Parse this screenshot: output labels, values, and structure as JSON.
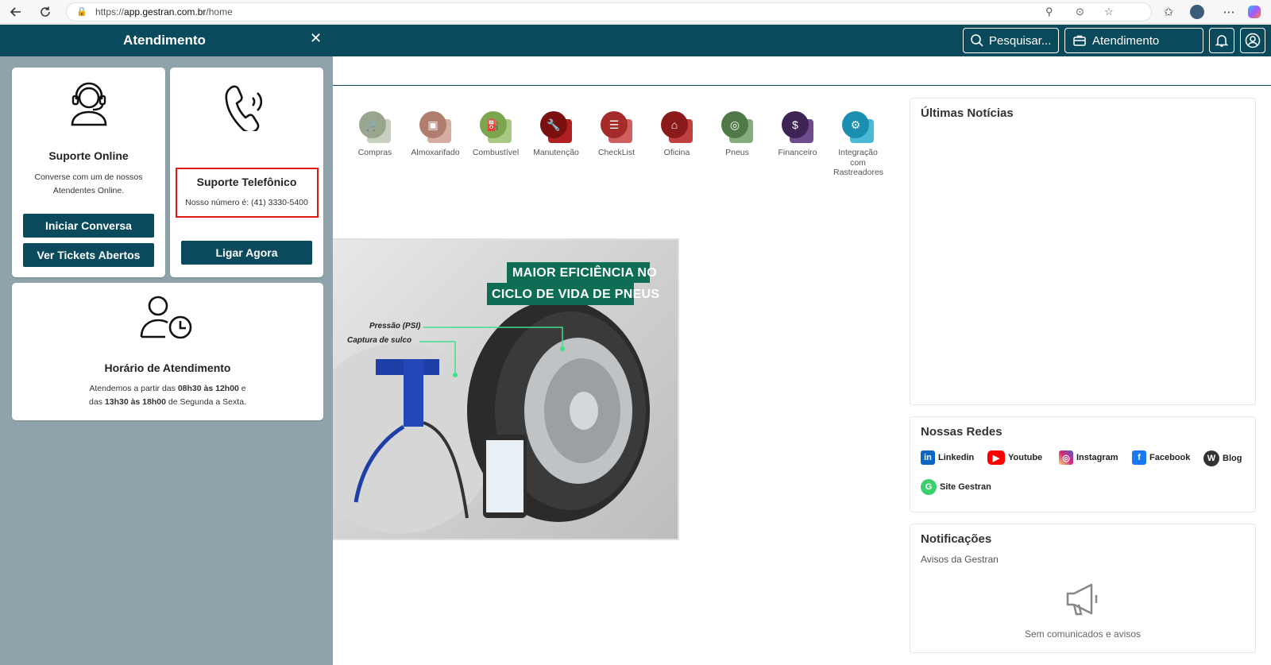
{
  "browser": {
    "url_scheme": "https://",
    "url_host": "app.gestran.com.br",
    "url_path": "/home"
  },
  "header": {
    "search_label": "Pesquisar...",
    "atendimento_label": "Atendimento"
  },
  "modules": [
    {
      "label": "Compras",
      "color": "#9aa58e",
      "color2": "#c7cfbe",
      "icon": "cart-icon"
    },
    {
      "label": "Almoxarifado",
      "color": "#b07d6e",
      "color2": "#d6ada1",
      "icon": "box-icon"
    },
    {
      "label": "Combustível",
      "color": "#7aa64d",
      "color2": "#a7c883",
      "icon": "fuel-icon"
    },
    {
      "label": "Manutenção",
      "color": "#7a1010",
      "color2": "#b02020",
      "icon": "wrench-icon"
    },
    {
      "label": "CheckList",
      "color": "#a52a2a",
      "color2": "#d06060",
      "icon": "checklist-icon"
    },
    {
      "label": "Oficina",
      "color": "#8b1a1a",
      "color2": "#c04040",
      "icon": "garage-icon"
    },
    {
      "label": "Pneus",
      "color": "#4f7a48",
      "color2": "#86ad7c",
      "icon": "tire-icon"
    },
    {
      "label": "Financeiro",
      "color": "#3d2454",
      "color2": "#6d4b8c",
      "icon": "money-icon"
    },
    {
      "label": "Integração com Rastreadores",
      "color": "#1a8fb0",
      "color2": "#4bb8d6",
      "icon": "tracker-icon"
    }
  ],
  "banner": {
    "headline_1": "MAIOR EFICIÊNCIA NO",
    "headline_2": "CICLO DE VIDA DE PNEUS",
    "label_pressure": "Pressão (PSI)",
    "label_groove": "Captura de sulco"
  },
  "news": {
    "title": "Últimas Notícias"
  },
  "networks": {
    "title": "Nossas Redes",
    "items": [
      {
        "label": "Linkedin",
        "color": "#0a66c2"
      },
      {
        "label": "Youtube",
        "color": "#ff0000"
      },
      {
        "label": "Instagram",
        "color": "#d62976"
      },
      {
        "label": "Facebook",
        "color": "#1877f2"
      },
      {
        "label": "Blog",
        "color": "#333333"
      },
      {
        "label": "Site Gestran",
        "color": "#3ccf6e"
      }
    ]
  },
  "notifications": {
    "title": "Notificações",
    "subtitle": "Avisos da Gestran",
    "empty": "Sem comunicados e avisos"
  },
  "drawer": {
    "title": "Atendimento",
    "online": {
      "title": "Suporte Online",
      "text_1": "Converse com um de nossos",
      "text_2": "Atendentes Online.",
      "btn_start": "Iniciar Conversa",
      "btn_tickets": "Ver Tickets Abertos"
    },
    "phone": {
      "title": "Suporte Telefônico",
      "text": "Nosso número é: (41) 3330-5400",
      "btn_call": "Ligar Agora"
    },
    "hours": {
      "title": "Horário de Atendimento",
      "l1_a": "Atendemos a partir das ",
      "l1_b": "08h30 às 12h00",
      "l1_c": " e",
      "l2_a": "das ",
      "l2_b": "13h30 às 18h00",
      "l2_c": " de Segunda a Sexta."
    }
  },
  "colors": {
    "primary": "#0b4a5c",
    "drawer_bg": "#8fa4aa",
    "highlight": "#e01919"
  }
}
